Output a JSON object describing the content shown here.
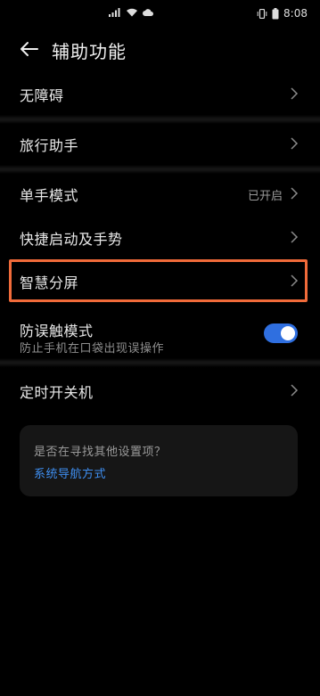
{
  "status_bar": {
    "time": "8:08",
    "icons": [
      "signal-icon",
      "wifi-icon",
      "cloud-icon",
      "vibrate-icon",
      "battery-icon"
    ]
  },
  "header": {
    "title": "辅助功能"
  },
  "menu": {
    "accessibility": "无障碍",
    "travel_assistant": "旅行助手",
    "one_hand_mode": "单手模式",
    "one_hand_mode_value": "已开启",
    "shortcuts_gestures": "快捷启动及手势",
    "smart_split": "智慧分屏",
    "mistouch_mode": "防误触模式",
    "mistouch_mode_desc": "防止手机在口袋出现误操作",
    "mistouch_enabled": true,
    "scheduled_power": "定时开关机"
  },
  "card": {
    "question": "是否在寻找其他设置项？",
    "link": "系统导航方式"
  },
  "colors": {
    "background": "#000000",
    "highlight_border": "#f16b3a",
    "toggle_on": "#2f6fe0",
    "link": "#3e8ef0"
  }
}
